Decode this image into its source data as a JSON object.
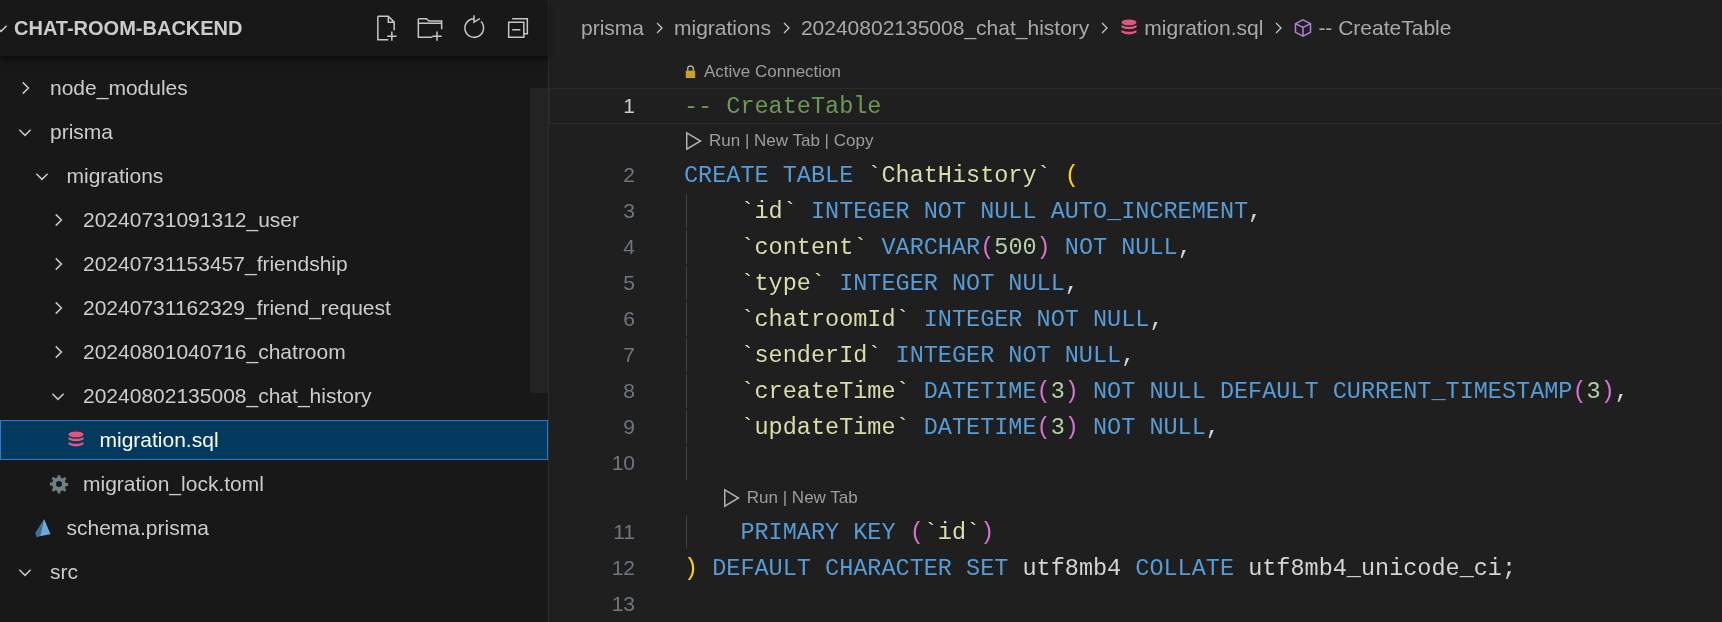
{
  "explorer": {
    "title": "CHAT-ROOM-BACKEND",
    "expanded": true,
    "tree": [
      {
        "name": "node_modules",
        "kind": "folder",
        "expanded": false,
        "selected": false
      },
      {
        "name": "prisma",
        "kind": "folder",
        "expanded": true,
        "selected": false,
        "children": [
          {
            "name": "migrations",
            "kind": "folder",
            "expanded": true,
            "selected": false,
            "children": [
              {
                "name": "20240731091312_user",
                "kind": "folder",
                "expanded": false,
                "selected": false
              },
              {
                "name": "20240731153457_friendship",
                "kind": "folder",
                "expanded": false,
                "selected": false
              },
              {
                "name": "20240731162329_friend_request",
                "kind": "folder",
                "expanded": false,
                "selected": false
              },
              {
                "name": "20240801040716_chatroom",
                "kind": "folder",
                "expanded": false,
                "selected": false
              },
              {
                "name": "20240802135008_chat_history",
                "kind": "folder",
                "expanded": true,
                "selected": false,
                "children": [
                  {
                    "name": "migration.sql",
                    "kind": "sql",
                    "selected": true
                  }
                ]
              },
              {
                "name": "migration_lock.toml",
                "kind": "config",
                "selected": false
              }
            ]
          },
          {
            "name": "schema.prisma",
            "kind": "prisma",
            "selected": false
          }
        ]
      },
      {
        "name": "src",
        "kind": "folder",
        "expanded": true,
        "selected": false
      }
    ]
  },
  "breadcrumb": [
    {
      "label": "prisma",
      "kind": "folder"
    },
    {
      "label": "migrations",
      "kind": "folder"
    },
    {
      "label": "20240802135008_chat_history",
      "kind": "folder"
    },
    {
      "label": "migration.sql",
      "kind": "sql"
    },
    {
      "label": "-- CreateTable",
      "kind": "symbol"
    }
  ],
  "editor": {
    "lines": [
      {
        "number": "1",
        "current": true,
        "lens": {
          "kind": "connection",
          "text": "Active Connection"
        },
        "tokens": [
          {
            "text": "-- CreateTable",
            "kind": "comment"
          }
        ]
      },
      {
        "number": "2",
        "current": false,
        "lens": {
          "kind": "run",
          "text": "Run | New Tab | Copy"
        },
        "tokens": [
          {
            "text": "CREATE TABLE",
            "kind": "keyword"
          },
          {
            "text": " `ChatHistory`",
            "kind": "identifier"
          },
          {
            "text": " (",
            "kind": "bracket"
          }
        ]
      },
      {
        "number": "3",
        "current": false,
        "tokens": [
          {
            "text": "    `id`",
            "kind": "identifier"
          },
          {
            "text": " INTEGER NOT NULL AUTO_INCREMENT",
            "kind": "keyword"
          },
          {
            "text": ",",
            "kind": "plain"
          }
        ]
      },
      {
        "number": "4",
        "current": false,
        "tokens": [
          {
            "text": "    `content`",
            "kind": "identifier"
          },
          {
            "text": " VARCHAR",
            "kind": "keyword"
          },
          {
            "text": "(",
            "kind": "paren"
          },
          {
            "text": "500",
            "kind": "number"
          },
          {
            "text": ")",
            "kind": "paren"
          },
          {
            "text": " NOT NULL",
            "kind": "keyword"
          },
          {
            "text": ",",
            "kind": "plain"
          }
        ]
      },
      {
        "number": "5",
        "current": false,
        "tokens": [
          {
            "text": "    `type`",
            "kind": "identifier"
          },
          {
            "text": " INTEGER NOT NULL",
            "kind": "keyword"
          },
          {
            "text": ",",
            "kind": "plain"
          }
        ]
      },
      {
        "number": "6",
        "current": false,
        "tokens": [
          {
            "text": "    `chatroomId`",
            "kind": "identifier"
          },
          {
            "text": " INTEGER NOT NULL",
            "kind": "keyword"
          },
          {
            "text": ",",
            "kind": "plain"
          }
        ]
      },
      {
        "number": "7",
        "current": false,
        "tokens": [
          {
            "text": "    `senderId`",
            "kind": "identifier"
          },
          {
            "text": " INTEGER NOT NULL",
            "kind": "keyword"
          },
          {
            "text": ",",
            "kind": "plain"
          }
        ]
      },
      {
        "number": "8",
        "current": false,
        "tokens": [
          {
            "text": "    `createTime`",
            "kind": "identifier"
          },
          {
            "text": " DATETIME",
            "kind": "keyword"
          },
          {
            "text": "(",
            "kind": "paren"
          },
          {
            "text": "3",
            "kind": "number"
          },
          {
            "text": ")",
            "kind": "paren"
          },
          {
            "text": " NOT NULL DEFAULT CURRENT_TIMESTAMP",
            "kind": "keyword"
          },
          {
            "text": "(",
            "kind": "paren"
          },
          {
            "text": "3",
            "kind": "number"
          },
          {
            "text": ")",
            "kind": "paren"
          },
          {
            "text": ",",
            "kind": "plain"
          }
        ]
      },
      {
        "number": "9",
        "current": false,
        "tokens": [
          {
            "text": "    `updateTime`",
            "kind": "identifier"
          },
          {
            "text": " DATETIME",
            "kind": "keyword"
          },
          {
            "text": "(",
            "kind": "paren"
          },
          {
            "text": "3",
            "kind": "number"
          },
          {
            "text": ")",
            "kind": "paren"
          },
          {
            "text": " NOT NULL",
            "kind": "keyword"
          },
          {
            "text": ",",
            "kind": "plain"
          }
        ]
      },
      {
        "number": "10",
        "current": false
      },
      {
        "number": "11",
        "current": false,
        "lens": {
          "kind": "run",
          "text": "Run | New Tab"
        },
        "tokens": [
          {
            "text": "    PRIMARY KEY",
            "kind": "keyword"
          },
          {
            "text": " (",
            "kind": "paren"
          },
          {
            "text": "`id`",
            "kind": "identifier"
          },
          {
            "text": ")",
            "kind": "paren"
          }
        ]
      },
      {
        "number": "12",
        "current": false,
        "tokens": [
          {
            "text": ")",
            "kind": "bracket"
          },
          {
            "text": " DEFAULT CHARACTER SET",
            "kind": "keyword"
          },
          {
            "text": " utf8mb4",
            "kind": "plain"
          },
          {
            "text": " COLLATE",
            "kind": "keyword"
          },
          {
            "text": " utf8mb4_unicode_ci;",
            "kind": "plain"
          }
        ]
      },
      {
        "number": "13",
        "current": false
      }
    ]
  }
}
